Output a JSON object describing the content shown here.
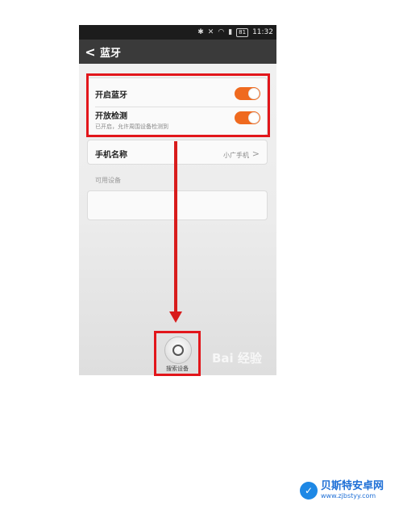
{
  "status_bar": {
    "time": "11:32",
    "battery": "81",
    "bluetooth_icon": "bluetooth-icon",
    "wifi_icon": "wifi-icon",
    "signal_icon": "signal-icon"
  },
  "title_bar": {
    "title": "蓝牙",
    "back_icon": "chevron-left-icon"
  },
  "bluetooth_card": {
    "enable_label": "开启蓝牙",
    "enable_on": true,
    "discover_label": "开放检测",
    "discover_sub": "已开启，允许周围设备检测到",
    "discover_on": true
  },
  "device_name": {
    "label": "手机名称",
    "value": "小广手机"
  },
  "available_devices": {
    "label": "可用设备"
  },
  "scan": {
    "label": "搜索设备"
  },
  "watermark": "Bai 经验",
  "logo": {
    "name": "贝斯特安卓网",
    "url": "www.zjbstyy.com"
  },
  "colors": {
    "accent": "#ef6a1f",
    "highlight": "#e2161b",
    "titlebar": "#3a3a3a"
  }
}
